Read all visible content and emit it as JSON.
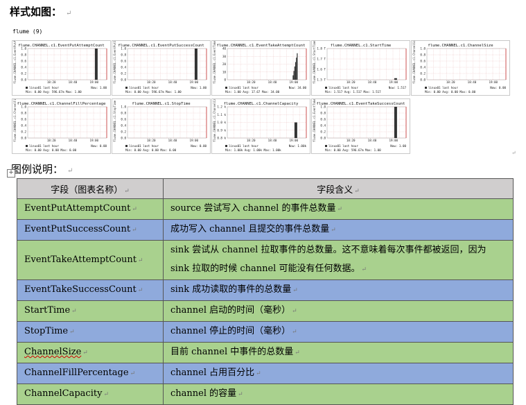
{
  "heading_style": "样式如图：",
  "flume_label": "flume (9)",
  "charts": [
    {
      "title": "flume.CHANNEL.c1.EventPutAttemptCount",
      "ylabel": "flume.CHANNEL.c1.EventPutAttemptCount",
      "yticks": [
        "1.0",
        "0.8",
        "0.6",
        "0.4",
        "0.2",
        "0.0"
      ],
      "xticks": [
        "18:20",
        "18:40",
        "19:00"
      ],
      "legend": "linux01 last hour",
      "now": "Now:   1.00",
      "stats": "Min:  0.00  Avg: 596.67m  Max:   1.00",
      "spike": [
        0,
        1.0
      ],
      "spike_at": 0.85
    },
    {
      "title": "flume.CHANNEL.c1.EventPutSuccessCount",
      "ylabel": "flume.CHANNEL.c1.EventPutSuccessCount",
      "yticks": [
        "1.0",
        "0.8",
        "0.6",
        "0.4",
        "0.2",
        "0.0"
      ],
      "xticks": [
        "18:20",
        "18:40",
        "19:00"
      ],
      "legend": "linux01 last hour",
      "now": "Now:   1.00",
      "stats": "Min:  0.00  Avg: 596.67m  Max:   1.00",
      "spike": [
        0,
        1.0
      ],
      "spike_at": 0.85
    },
    {
      "title": "flume.CHANNEL.c1.EventTakeAttemptCount",
      "ylabel": "flume.CHANNEL.c1.EventTakeAttemptCount",
      "yticks": [
        "40",
        "30",
        "20",
        "10",
        "0"
      ],
      "xticks": [
        "18:20",
        "18:40",
        "19:00"
      ],
      "legend": "linux01 last hour",
      "now": "Now:  34.00",
      "stats": "Min:  1.00  Avg: 17.67  Max:  34.00",
      "spike": [
        0,
        0.85
      ],
      "spike_at": 0.88,
      "ramp": true
    },
    {
      "title": "flume.CHANNEL.c1.StartTime",
      "ylabel": "flume.CHANNEL.c1.StartTime",
      "yticks": [
        "1.8 T",
        "1.7 T",
        "1.6 T",
        "1.5 T"
      ],
      "xticks": [
        "18:20",
        "18:40",
        "19:00"
      ],
      "legend": "linux01 last hour",
      "now": "Now:  1.517",
      "stats": "Min:  1.517  Avg:  1.517  Max:  1.517",
      "spike": [
        0,
        0.05
      ],
      "spike_at": 0.85
    },
    {
      "title": "flume.CHANNEL.c1.ChannelSize",
      "ylabel": "flume.CHANNEL.c1.ChannelSize",
      "yticks": [
        "1.0",
        "0.8",
        "0.6",
        "0.4",
        "0.2",
        "0.0"
      ],
      "xticks": [
        "18:20",
        "18:40",
        "19:00"
      ],
      "legend": "linux01 last hour",
      "now": "Now:   0.00",
      "stats": "Min:  0.00  Avg:  0.00  Max:   0.00",
      "spike": [
        0,
        0
      ],
      "spike_at": 0.85
    },
    {
      "title": "flume.CHANNEL.c1.ChannelFillPercentage",
      "ylabel": "flume.CHANNEL.c1.ChannelFillPercentage",
      "yticks": [
        "1.0",
        "0.8",
        "0.6",
        "0.4",
        "0.2",
        "0.0"
      ],
      "xticks": [
        "18:20",
        "18:40",
        "19:00"
      ],
      "legend": "linux01 last hour",
      "now": "Now:   0.00",
      "stats": "Min:  0.00  Avg:  0.00  Max:   0.00",
      "spike": [
        0,
        0
      ],
      "spike_at": 0.85
    },
    {
      "title": "flume.CHANNEL.c1.StopTime",
      "ylabel": "flume.CHANNEL.c1.StopTime",
      "yticks": [
        "1.0",
        "0.8",
        "0.6",
        "0.4",
        "0.2",
        "0.0"
      ],
      "xticks": [
        "18:20",
        "18:40",
        "19:00"
      ],
      "legend": "linux01 last hour",
      "now": "Now:   0.00",
      "stats": "Min:  0.00  Avg:  0.00  Max:   0.00",
      "spike": [
        0,
        0
      ],
      "spike_at": 0.85
    },
    {
      "title": "flume.CHANNEL.c1.ChannelCapacity",
      "ylabel": "flume.CHANNEL.c1.ChannelCapacity",
      "yticks": [
        "1.2 k",
        "1.1 k",
        "1.0 k",
        "0.9 k",
        "0.8 k"
      ],
      "xticks": [
        "18:20",
        "18:40",
        "19:00"
      ],
      "legend": "linux01 last hour",
      "now": "Now:   1.00k",
      "stats": "Min:  1.00k  Avg:  1.00k  Max:   1.00k",
      "spike": [
        0,
        0.5
      ],
      "spike_at": 0.85
    },
    {
      "title": "flume.CHANNEL.c1.EventTakeSuccessCount",
      "ylabel": "flume.CHANNEL.c1.EventTakeSuccessCount",
      "yticks": [
        "1.0",
        "0.8",
        "0.6",
        "0.4",
        "0.2",
        "0.0"
      ],
      "xticks": [
        "18:20",
        "18:40",
        "19:00"
      ],
      "legend": "linux01 last hour",
      "now": "Now:   1.00",
      "stats": "Min:  0.00  Avg: 596.67m  Max:   1.00",
      "spike": [
        0,
        1.0
      ],
      "spike_at": 0.85
    }
  ],
  "heading_legend": "图例说明：",
  "table": {
    "headers": [
      "字段（图表名称）",
      "字段含义"
    ],
    "rows": [
      {
        "name": "EventPutAttemptCount",
        "desc": "source 尝试写入 channel 的事件总数量",
        "color": "green"
      },
      {
        "name": "EventPutSuccessCount",
        "desc": "成功写入 channel 且提交的事件总数量",
        "color": "blue"
      },
      {
        "name": "EventTakeAttemptCount",
        "desc": "sink 尝试从 channel 拉取事件的总数量。这不意味着每次事件都被返回，因为 sink 拉取的时候 channel 可能没有任何数据。",
        "color": "green"
      },
      {
        "name": "EventTakeSuccessCount",
        "desc": "sink 成功读取的事件的总数量",
        "color": "blue"
      },
      {
        "name": "StartTime",
        "desc": "channel 启动的时间（毫秒）",
        "color": "green"
      },
      {
        "name": "StopTime",
        "desc": "channel 停止的时间（毫秒）",
        "color": "blue"
      },
      {
        "name": "ChannelSize",
        "desc": "目前 channel 中事件的总数量",
        "color": "green"
      },
      {
        "name": "ChannelFillPercentage",
        "desc": "channel 占用百分比",
        "color": "blue"
      },
      {
        "name": "ChannelCapacity",
        "desc": "channel 的容量",
        "color": "green"
      }
    ]
  }
}
